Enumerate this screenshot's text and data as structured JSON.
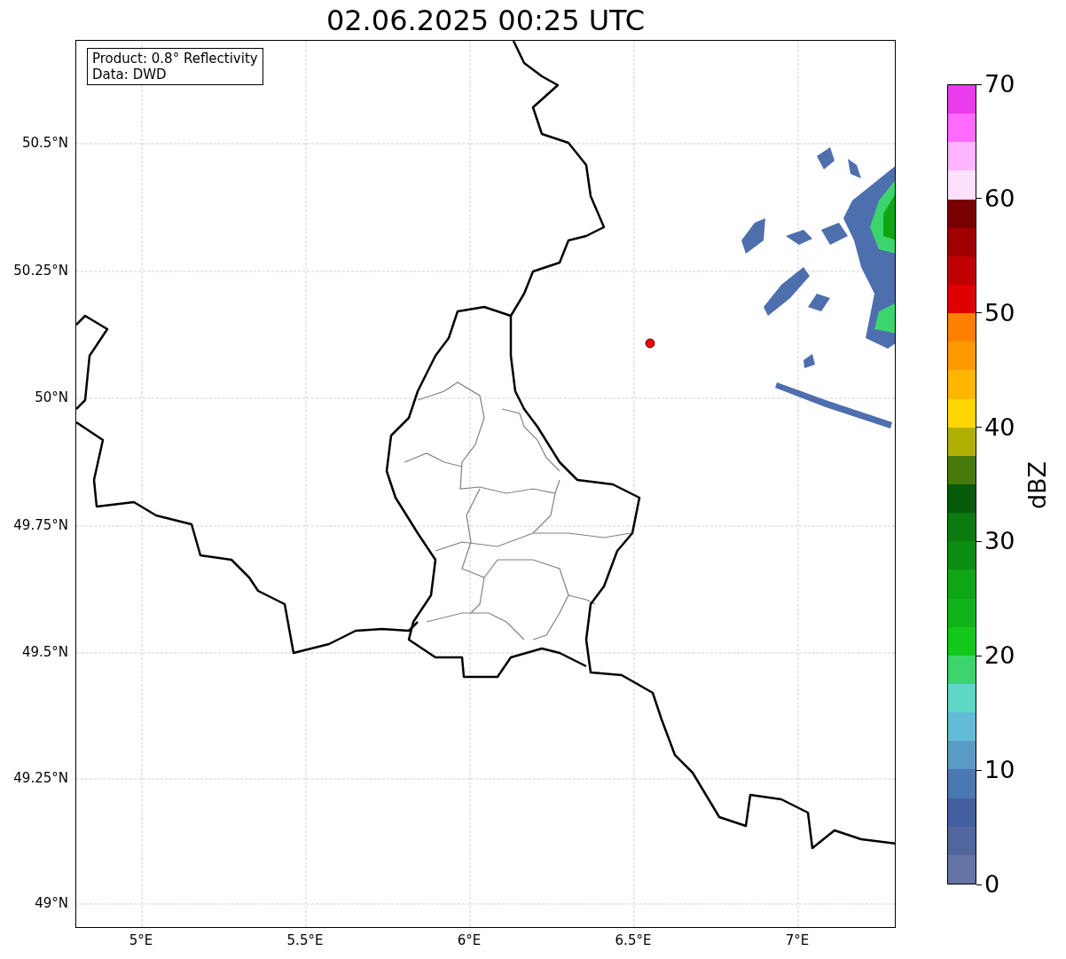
{
  "title": "02.06.2025 00:25 UTC",
  "info_box": {
    "lines": [
      "Product: 0.8° Reflectivity",
      "Data: DWD"
    ]
  },
  "y_ticks": [
    "50.5°N",
    "50.25°N",
    "50°N",
    "49.75°N",
    "49.5°N",
    "49.25°N",
    "49°N"
  ],
  "x_ticks": [
    "5°E",
    "5.5°E",
    "6°E",
    "6.5°E",
    "7°E"
  ],
  "colorbar": {
    "label": "dBZ",
    "ticks": [
      "70",
      "60",
      "50",
      "40",
      "30",
      "20",
      "10",
      "0"
    ],
    "bins": [
      {
        "color": "#6673a6"
      },
      {
        "color": "#52669e"
      },
      {
        "color": "#4560a0"
      },
      {
        "color": "#4a78b0"
      },
      {
        "color": "#5a9bc6"
      },
      {
        "color": "#62bcd9"
      },
      {
        "color": "#5fd6c6"
      },
      {
        "color": "#3cd46c"
      },
      {
        "color": "#12c81a"
      },
      {
        "color": "#10b41a"
      },
      {
        "color": "#0ea614"
      },
      {
        "color": "#0b8c12"
      },
      {
        "color": "#0c7a10"
      },
      {
        "color": "#065a0a"
      },
      {
        "color": "#477a0a"
      },
      {
        "color": "#b0b004"
      },
      {
        "color": "#ffd700"
      },
      {
        "color": "#ffb600"
      },
      {
        "color": "#ff9900"
      },
      {
        "color": "#ff7f00"
      },
      {
        "color": "#e00000"
      },
      {
        "color": "#c00000"
      },
      {
        "color": "#a00000"
      },
      {
        "color": "#780000"
      },
      {
        "color": "#ffe0ff"
      },
      {
        "color": "#ffb4ff"
      },
      {
        "color": "#ff6aff"
      },
      {
        "color": "#ea3cea"
      }
    ]
  }
}
